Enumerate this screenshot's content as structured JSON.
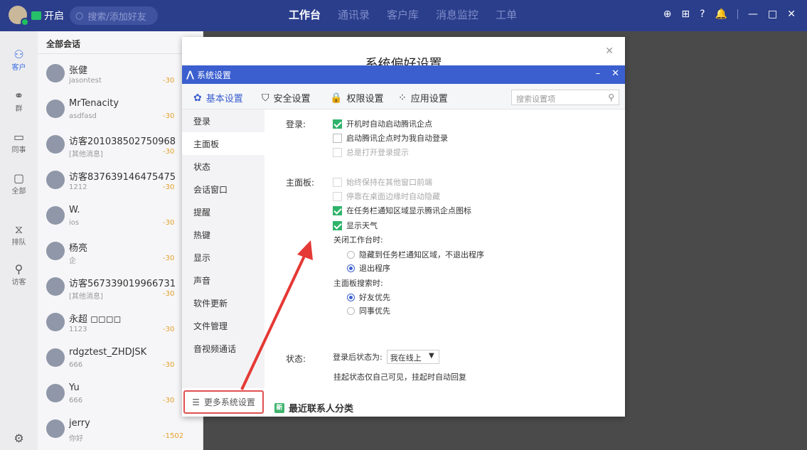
{
  "topbar": {
    "status": "开启",
    "search_placeholder": "搜索/添加好友",
    "nav": [
      "工作台",
      "通讯录",
      "客户库",
      "消息监控",
      "工单"
    ],
    "tools": [
      "⊕",
      "⊞",
      "?",
      "🔔",
      "—",
      "□",
      "✕"
    ]
  },
  "rail": {
    "items": [
      "客户",
      "群",
      "同事",
      "全部",
      "排队",
      "访客"
    ]
  },
  "conversations": {
    "header": "全部会话",
    "items": [
      {
        "name": "张健",
        "sub": "jasontest",
        "tag": "-30"
      },
      {
        "name": "MrTenacity",
        "sub": "asdfasd",
        "tag": "-30"
      },
      {
        "name": "访客201038502750968",
        "sub": "[其他消息]",
        "tag": "-30"
      },
      {
        "name": "访客837639146475475",
        "sub": "1212",
        "tag": "-30"
      },
      {
        "name": "W.",
        "sub": "ios",
        "tag": "-30"
      },
      {
        "name": "杨亮",
        "sub": "企",
        "tag": "-30"
      },
      {
        "name": "访客567339019966731",
        "sub": "[其他消息]",
        "tag": "-30"
      },
      {
        "name": "永超 ◻◻◻◻",
        "sub": "1123",
        "tag": "-30"
      },
      {
        "name": "rdgztest_ZHDJSK",
        "sub": "666",
        "tag": "-30"
      },
      {
        "name": "Yu",
        "sub": "666",
        "tag": "-30"
      },
      {
        "name": "jerry",
        "sub": "你好",
        "tag": "-1502"
      }
    ]
  },
  "dialog": {
    "outer_title": "系统偏好设置",
    "inner_title": "系统设置",
    "tabs": [
      "基本设置",
      "安全设置",
      "权限设置",
      "应用设置"
    ],
    "search_placeholder": "搜索设置项",
    "menu": [
      "登录",
      "主面板",
      "状态",
      "会话窗口",
      "提醒",
      "热键",
      "显示",
      "声音",
      "软件更新",
      "文件管理",
      "音视频通话"
    ],
    "login_label": "登录:",
    "login_opts": [
      "开机时自动启动腾讯企点",
      "启动腾讯企点时为我自动登录",
      "总是打开登录提示"
    ],
    "panel_label": "主面板:",
    "panel_opts": [
      "始终保持在其他窗口前端",
      "停靠在桌面边缘时自动隐藏",
      "在任务栏通知区域显示腾讯企点图标",
      "显示天气"
    ],
    "close_label": "关闭工作台时:",
    "close_opts": [
      "隐藏到任务栏通知区域，不退出程序",
      "退出程序"
    ],
    "search_label": "主面板搜索时:",
    "search_opts": [
      "好友优先",
      "同事优先"
    ],
    "status_label": "状态:",
    "status_after_login": "登录后状态为:",
    "status_value": "我在线上",
    "status_note": "挂起状态仅自己可见，挂起时自动回复",
    "more_settings": "更多系统设置",
    "recent_contacts": "最近联系人分类",
    "new_badge": "新"
  }
}
